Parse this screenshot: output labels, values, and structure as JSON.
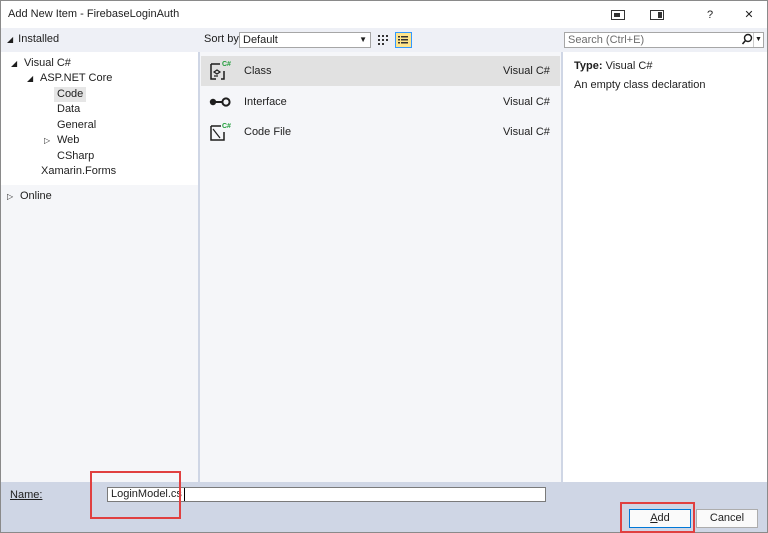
{
  "window": {
    "title": "Add New Item - FirebaseLoginAuth",
    "buttons": {
      "help": "?",
      "close": "✕"
    }
  },
  "header": {
    "installed_label": "Installed",
    "sort_by_label": "Sort by:",
    "sort_by_value": "Default",
    "search_placeholder": "Search (Ctrl+E)"
  },
  "tree": {
    "visual_csharp": "Visual C#",
    "aspnet_core": "ASP.NET Core",
    "code": "Code",
    "data": "Data",
    "general": "General",
    "web": "Web",
    "csharp": "CSharp",
    "xamarin_forms": "Xamarin.Forms",
    "online": "Online"
  },
  "templates": [
    {
      "name": "Class",
      "lang": "Visual C#",
      "selected": true
    },
    {
      "name": "Interface",
      "lang": "Visual C#",
      "selected": false
    },
    {
      "name": "Code File",
      "lang": "Visual C#",
      "selected": false
    }
  ],
  "details": {
    "type_label": "Type:",
    "type_value": "Visual C#",
    "description": "An empty class declaration"
  },
  "footer": {
    "name_label_first": "N",
    "name_label_rest": "ame:",
    "name_value": "LoginModel.cs",
    "add_label_first": "A",
    "add_label_rest": "dd",
    "cancel_label": "Cancel"
  },
  "colors": {
    "highlight": "#e04040",
    "accent": "#0078d7",
    "csharp_green": "#1f9d3a"
  }
}
